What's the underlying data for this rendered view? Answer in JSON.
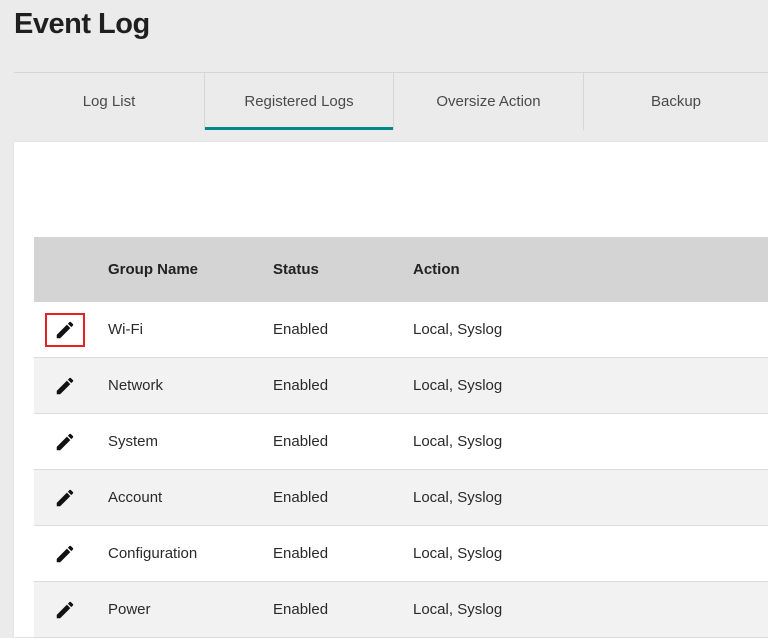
{
  "page": {
    "title": "Event Log"
  },
  "tabs": [
    {
      "label": "Log List",
      "active": false
    },
    {
      "label": "Registered Logs",
      "active": true
    },
    {
      "label": "Oversize Action",
      "active": false
    },
    {
      "label": "Backup",
      "active": false
    }
  ],
  "table": {
    "columns": {
      "group_name": "Group Name",
      "status": "Status",
      "action": "Action"
    },
    "rows": [
      {
        "group_name": "Wi-Fi",
        "status": "Enabled",
        "action": "Local, Syslog",
        "icon": "edit-icon"
      },
      {
        "group_name": "Network",
        "status": "Enabled",
        "action": "Local, Syslog",
        "icon": "edit-icon"
      },
      {
        "group_name": "System",
        "status": "Enabled",
        "action": "Local, Syslog",
        "icon": "edit-icon"
      },
      {
        "group_name": "Account",
        "status": "Enabled",
        "action": "Local, Syslog",
        "icon": "edit-icon"
      },
      {
        "group_name": "Configuration",
        "status": "Enabled",
        "action": "Local, Syslog",
        "icon": "edit-icon"
      },
      {
        "group_name": "Power",
        "status": "Enabled",
        "action": "Local, Syslog",
        "icon": "edit-icon"
      }
    ]
  },
  "colors": {
    "accent": "#008787",
    "highlight": "#e02424",
    "header_bg": "#d4d4d4"
  }
}
